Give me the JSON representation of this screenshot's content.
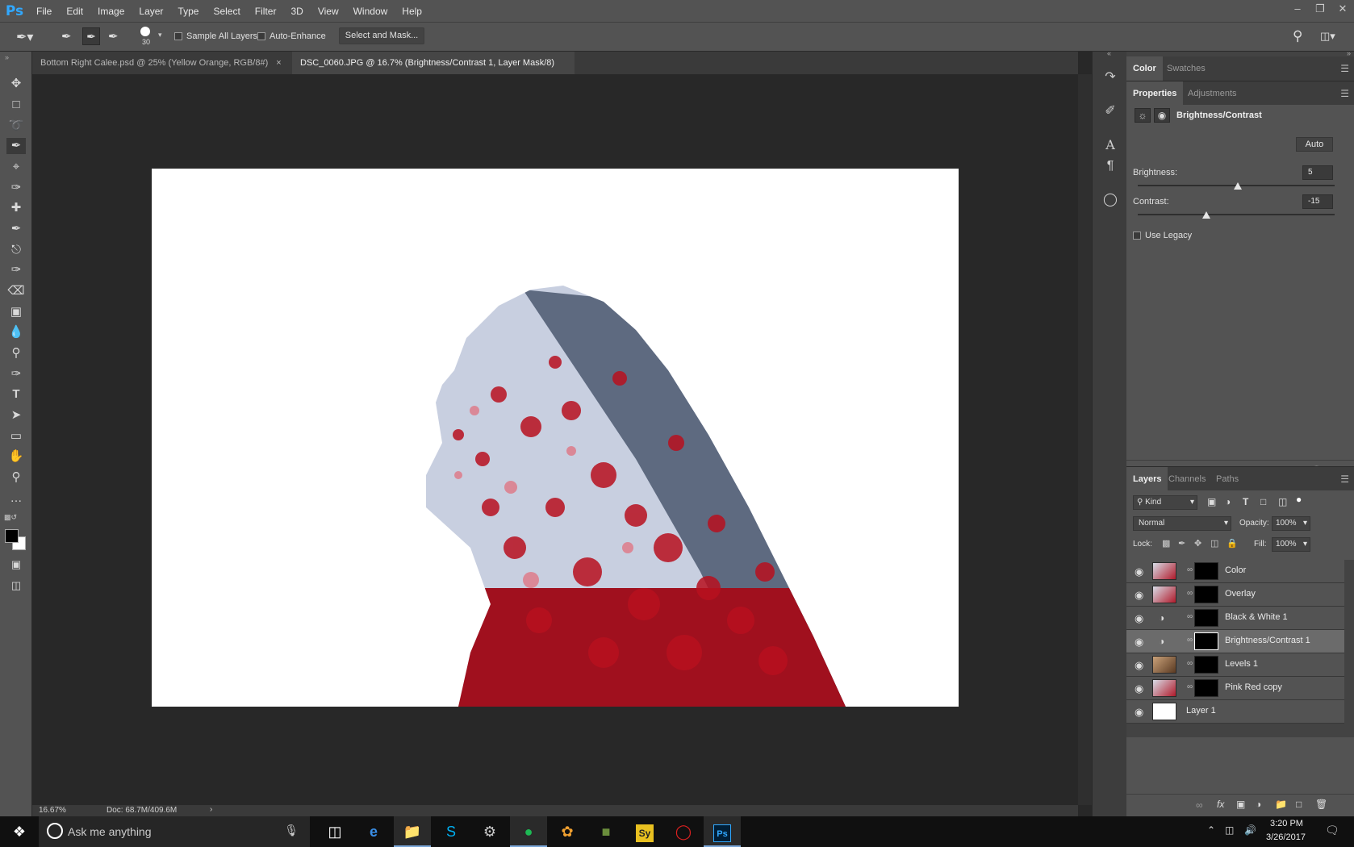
{
  "menubar": {
    "logo": "Ps",
    "items": [
      "File",
      "Edit",
      "Image",
      "Layer",
      "Type",
      "Select",
      "Filter",
      "3D",
      "View",
      "Window",
      "Help"
    ]
  },
  "options_bar": {
    "brush_size": "30",
    "sample_all_layers_label": "Sample All Layers",
    "sample_all_layers_checked": false,
    "auto_enhance_label": "Auto-Enhance",
    "auto_enhance_checked": false,
    "select_and_mask_label": "Select and Mask..."
  },
  "document_tabs": [
    {
      "title": "Bottom Right Calee.psd @ 25% (Yellow Orange, RGB/8#)",
      "active": false
    },
    {
      "title": "DSC_0060.JPG @ 16.7% (Brightness/Contrast 1, Layer Mask/8) *",
      "active": true
    }
  ],
  "tools": [
    "move-icon",
    "marquee-icon",
    "lasso-icon",
    "quick-selection-icon",
    "crop-icon",
    "eyedropper-icon",
    "healing-brush-icon",
    "brush-icon",
    "clone-stamp-icon",
    "history-brush-icon",
    "eraser-icon",
    "gradient-icon",
    "blur-icon",
    "dodge-icon",
    "pen-icon",
    "type-icon",
    "path-selection-icon",
    "rectangle-icon",
    "hand-icon",
    "zoom-icon",
    "more-tools-icon"
  ],
  "status_bar": {
    "zoom": "16.67%",
    "doc_size": "Doc: 68.7M/409.6M"
  },
  "color_panel": {
    "tabs": [
      "Color",
      "Swatches"
    ]
  },
  "properties_panel": {
    "tabs": [
      "Properties",
      "Adjustments"
    ],
    "title": "Brightness/Contrast",
    "auto_label": "Auto",
    "brightness_label": "Brightness:",
    "brightness_value": "5",
    "brightness_level": 0.51,
    "contrast_label": "Contrast:",
    "contrast_value": "-15",
    "contrast_level": 0.35,
    "use_legacy_label": "Use Legacy",
    "use_legacy_checked": false
  },
  "layers_panel": {
    "tabs": [
      "Layers",
      "Channels",
      "Paths"
    ],
    "filter_kind": "Kind",
    "blend_mode": "Normal",
    "opacity_label": "Opacity:",
    "opacity_value": "100%",
    "lock_label": "Lock:",
    "fill_label": "Fill:",
    "fill_value": "100%",
    "layers": [
      {
        "name": "Color",
        "type": "image-mask",
        "selected": false
      },
      {
        "name": "Overlay",
        "type": "image-mask",
        "selected": false
      },
      {
        "name": "Black & White 1",
        "type": "adjustment",
        "selected": false
      },
      {
        "name": "Brightness/Contrast 1",
        "type": "adjustment",
        "selected": true
      },
      {
        "name": "Levels 1",
        "type": "image-mask",
        "selected": false
      },
      {
        "name": "Pink Red copy",
        "type": "image-mask",
        "selected": false
      },
      {
        "name": "Layer 1",
        "type": "plain",
        "selected": false
      }
    ]
  },
  "taskbar": {
    "search_placeholder": "Ask me anything",
    "time": "3:20 PM",
    "date": "3/26/2017"
  },
  "colors": {
    "accent": "#31a8ff",
    "canvas_bg": "#282828",
    "panel_bg": "#535353"
  }
}
